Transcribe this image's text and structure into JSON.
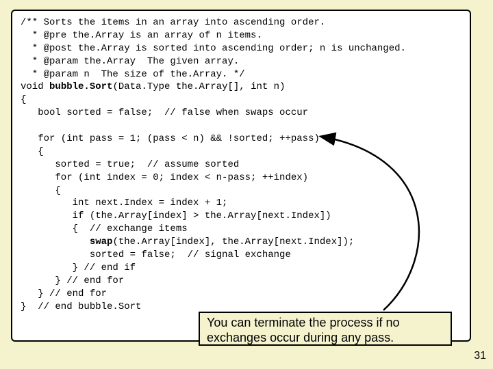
{
  "code": {
    "l01": "/** Sorts the items in an array into ascending order.",
    "l02": "  * @pre the.Array is an array of n items.",
    "l03": "  * @post the.Array is sorted into ascending order; n is unchanged.",
    "l04": "  * @param the.Array  The given array.",
    "l05": "  * @param n  The size of the.Array. */",
    "l06a": "void ",
    "l06b": "bubble.Sort",
    "l06c": "(Data.Type the.Array[], int n)",
    "l07": "{",
    "l08": "   bool sorted = false;  // false when swaps occur",
    "l09": "",
    "l10": "   for (int pass = 1; (pass < n) && !sorted; ++pass)",
    "l11": "   {",
    "l12": "      sorted = true;  // assume sorted",
    "l13": "      for (int index = 0; index < n-pass; ++index)",
    "l14": "      {",
    "l15": "         int next.Index = index + 1;",
    "l16": "         if (the.Array[index] > the.Array[next.Index])",
    "l17": "         {  // exchange items",
    "l18a": "            ",
    "l18b": "swap",
    "l18c": "(the.Array[index], the.Array[next.Index]);",
    "l19": "            sorted = false;  // signal exchange",
    "l20": "         } // end if",
    "l21": "      } // end for",
    "l22": "   } // end for",
    "l23": "}  // end bubble.Sort"
  },
  "callout": {
    "line1": "You can terminate the process if no",
    "line2": "exchanges occur during any pass."
  },
  "page_number": "31"
}
